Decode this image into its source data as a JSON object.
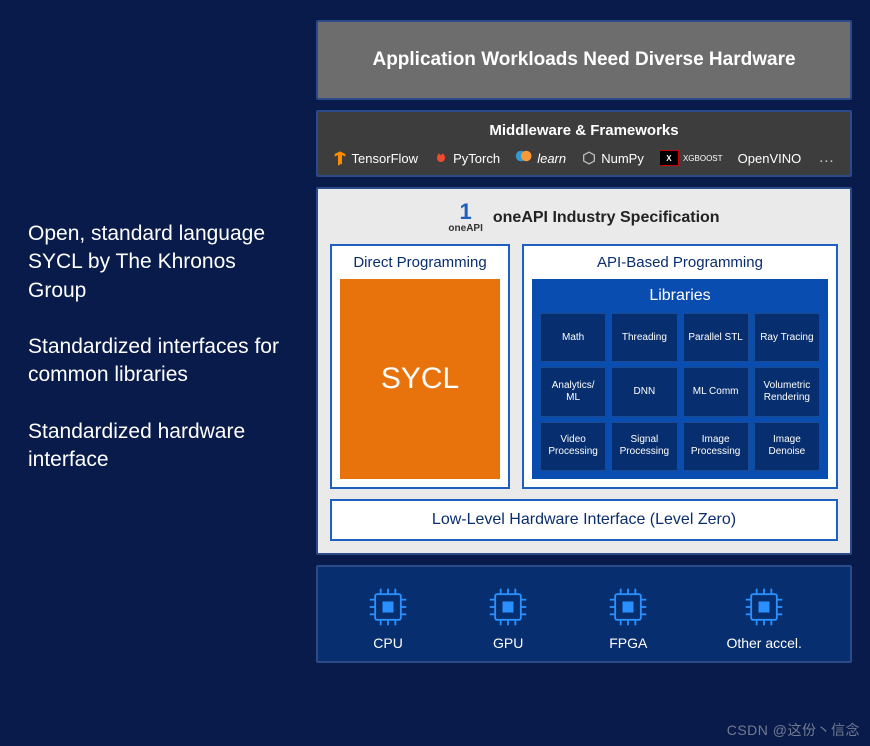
{
  "left_text": {
    "p1": "Open, standard language SYCL by The Khronos Group",
    "p2": "Standardized interfaces for common libraries",
    "p3": "Standardized hardware interface"
  },
  "workloads": {
    "title": "Application Workloads Need Diverse Hardware"
  },
  "middleware": {
    "title": "Middleware & Frameworks",
    "items": [
      "TensorFlow",
      "PyTorch",
      "learn",
      "NumPy",
      "XGBOOST",
      "OpenVINO"
    ],
    "more": "…"
  },
  "spec": {
    "logo_text": "oneAPI",
    "title": "oneAPI Industry Specification",
    "direct": {
      "title": "Direct Programming",
      "sycl": "SYCL"
    },
    "api": {
      "title": "API-Based Programming",
      "libs_title": "Libraries",
      "libs": [
        "Math",
        "Threading",
        "Parallel STL",
        "Ray Tracing",
        "Analytics/\nML",
        "DNN",
        "ML Comm",
        "Volumetric\nRendering",
        "Video\nProcessing",
        "Signal\nProcessing",
        "Image\nProcessing",
        "Image\nDenoise"
      ]
    },
    "lowlevel": "Low-Level Hardware Interface (Level Zero)"
  },
  "hardware": {
    "items": [
      "CPU",
      "GPU",
      "FPGA",
      "Other accel."
    ]
  },
  "watermark": "CSDN @这份丶信念"
}
